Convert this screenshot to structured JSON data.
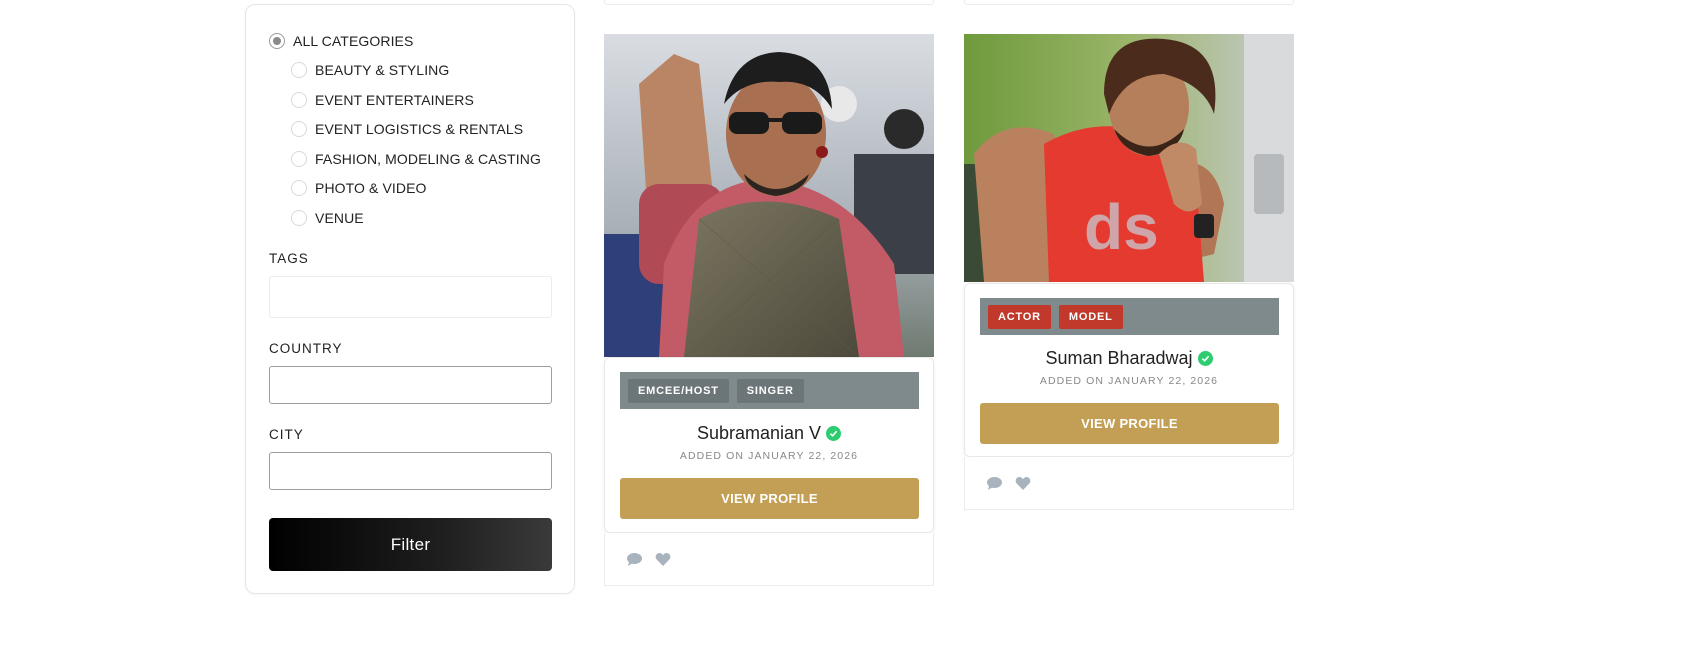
{
  "filters": {
    "categories": [
      {
        "label": "ALL CATEGORIES",
        "checked": true
      },
      {
        "label": "BEAUTY & STYLING",
        "checked": false
      },
      {
        "label": "EVENT ENTERTAINERS",
        "checked": false
      },
      {
        "label": "EVENT LOGISTICS & RENTALS",
        "checked": false
      },
      {
        "label": "FASHION, MODELING & CASTING",
        "checked": false
      },
      {
        "label": "PHOTO & VIDEO",
        "checked": false
      },
      {
        "label": "VENUE",
        "checked": false
      }
    ],
    "tags_label": "TAGS",
    "tags_value": "",
    "country_label": "COUNTRY",
    "country_value": "",
    "city_label": "CITY",
    "city_value": "",
    "filter_button": "Filter"
  },
  "cards": [
    {
      "tags": [
        {
          "label": "EMCEE/HOST",
          "color": "#6c7577"
        },
        {
          "label": "SINGER",
          "color": "#6c7577"
        }
      ],
      "name": "Subramanian V",
      "verified": true,
      "added_on": "ADDED ON JANUARY 22, 2026",
      "view_button": "VIEW PROFILE"
    },
    {
      "tags": [
        {
          "label": "ACTOR",
          "color": "#c0392b"
        },
        {
          "label": "MODEL",
          "color": "#c0392b"
        }
      ],
      "name": "Suman Bharadwaj",
      "verified": true,
      "added_on": "ADDED ON JANUARY 22, 2026",
      "view_button": "VIEW PROFILE"
    }
  ],
  "icons": {
    "verified": "check-circle-icon",
    "comment": "comment-icon",
    "like": "heart-icon"
  },
  "colors": {
    "accent_gold": "#c39e55",
    "tag_bar": "#7f8a8c",
    "tag_red": "#c0392b",
    "verified_green": "#2ecc71"
  }
}
